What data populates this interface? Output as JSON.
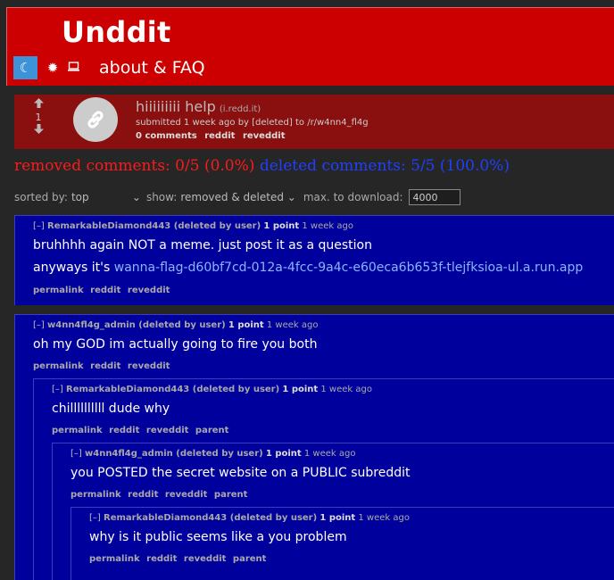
{
  "header": {
    "brand": "Unddit",
    "moon_glyph": "☾",
    "sun_glyph": "✹",
    "pc_glyph": "💻",
    "about": "about & FAQ"
  },
  "post": {
    "arrow_up": "🡅",
    "score": "1",
    "arrow_down": "🡇",
    "title": "hiiiiiiiii help",
    "domain": "(i.redd.it)",
    "submitted": "submitted 1 week ago by [deleted] to /r/w4nn4_fl4g",
    "links": [
      "0 comments",
      "reddit",
      "reveddit"
    ]
  },
  "stats": {
    "removed": "removed comments: 0/5 (0.0%)",
    "deleted": "deleted comments: 5/5 (100.0%)"
  },
  "controls": {
    "sorted_label": "sorted by:",
    "sorted_value": "top",
    "show_label": "show:",
    "show_value": "removed & deleted",
    "max_label": "max. to download:",
    "max_value": "4000"
  },
  "comments": [
    {
      "toggle": "[–]",
      "author": "RemarkableDiamond443 (deleted by user)",
      "points": "1 point",
      "time": "1 week ago",
      "body_line1": "bruhhhh again NOT a meme. just post it as a question",
      "body_line2_prefix": "anyways it's ",
      "body_link": "wanna-flag-d60bf7cd-012a-4fcc-9a4c-e60eca6b653f-tlejfksioa-ul.a.run.app",
      "links": [
        "permalink",
        "reddit",
        "reveddit"
      ]
    },
    {
      "toggle": "[–]",
      "author": "w4nn4fl4g_admin (deleted by user)",
      "points": "1 point",
      "time": "1 week ago",
      "body": "oh my GOD im actually going to fire you both",
      "links": [
        "permalink",
        "reddit",
        "reveddit"
      ]
    },
    {
      "toggle": "[–]",
      "author": "RemarkableDiamond443 (deleted by user)",
      "points": "1 point",
      "time": "1 week ago",
      "body": "chillllllllll dude why",
      "links": [
        "permalink",
        "reddit",
        "reveddit",
        "parent"
      ]
    },
    {
      "toggle": "[–]",
      "author": "w4nn4fl4g_admin (deleted by user)",
      "points": "1 point",
      "time": "1 week ago",
      "body": "you POSTED the secret website on a PUBLIC subreddit",
      "links": [
        "permalink",
        "reddit",
        "reveddit",
        "parent"
      ]
    },
    {
      "toggle": "[–]",
      "author": "RemarkableDiamond443 (deleted by user)",
      "points": "1 point",
      "time": "1 week ago",
      "body": "why is it public seems like a you problem",
      "links": [
        "permalink",
        "reddit",
        "reveddit",
        "parent"
      ]
    }
  ]
}
